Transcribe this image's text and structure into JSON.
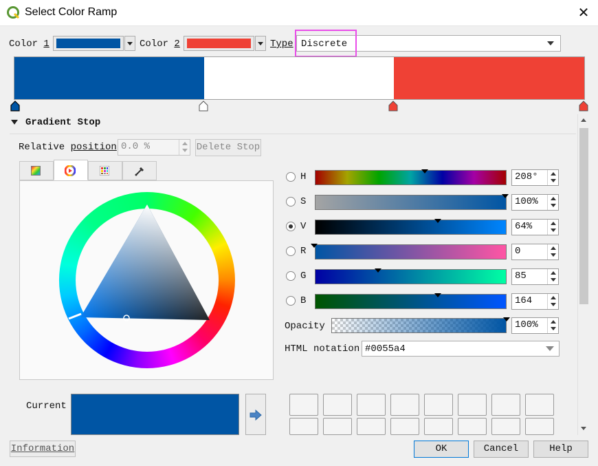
{
  "window": {
    "title": "Select Color Ramp",
    "close_glyph": "✕"
  },
  "top": {
    "color1_label": "Color",
    "color1_num": "1",
    "color1": "#0055a4",
    "color2_label": "Color",
    "color2_num": "2",
    "color2": "#ef4135",
    "type_label": "Type",
    "type_value": "Discrete"
  },
  "ramp": {
    "left_color": "#0055a4",
    "middle_color": "#ffffff",
    "right_color": "#ef4135"
  },
  "gradient_stop": {
    "header": "Gradient Stop",
    "relpos_label": "Relative",
    "relpos_label2": "position",
    "relpos_value": "0.0 %",
    "delete_button": "Delete Stop"
  },
  "picker": {
    "tabs": [
      "gradient-swatch-icon",
      "color-wheel-icon",
      "palette-grid-icon",
      "eyedropper-icon"
    ],
    "rows": [
      {
        "letter": "H",
        "value": "208°",
        "checked": false
      },
      {
        "letter": "S",
        "value": "100%",
        "checked": false
      },
      {
        "letter": "V",
        "value": "64%",
        "checked": true
      },
      {
        "letter": "R",
        "value": "0",
        "checked": false
      },
      {
        "letter": "G",
        "value": "85",
        "checked": false
      },
      {
        "letter": "B",
        "value": "164",
        "checked": false
      }
    ],
    "opacity_label": "Opacity",
    "opacity_value": "100%",
    "html_label": "HTML notation",
    "html_value": "#0055a4",
    "current_label": "Current",
    "current_color": "#0055a4"
  },
  "footer": {
    "information_button": "Information",
    "ok_button": "OK",
    "cancel_button": "Cancel",
    "help_button": "Help"
  },
  "colors": {
    "highlight": "#e94de9",
    "accent": "#0078d7"
  }
}
